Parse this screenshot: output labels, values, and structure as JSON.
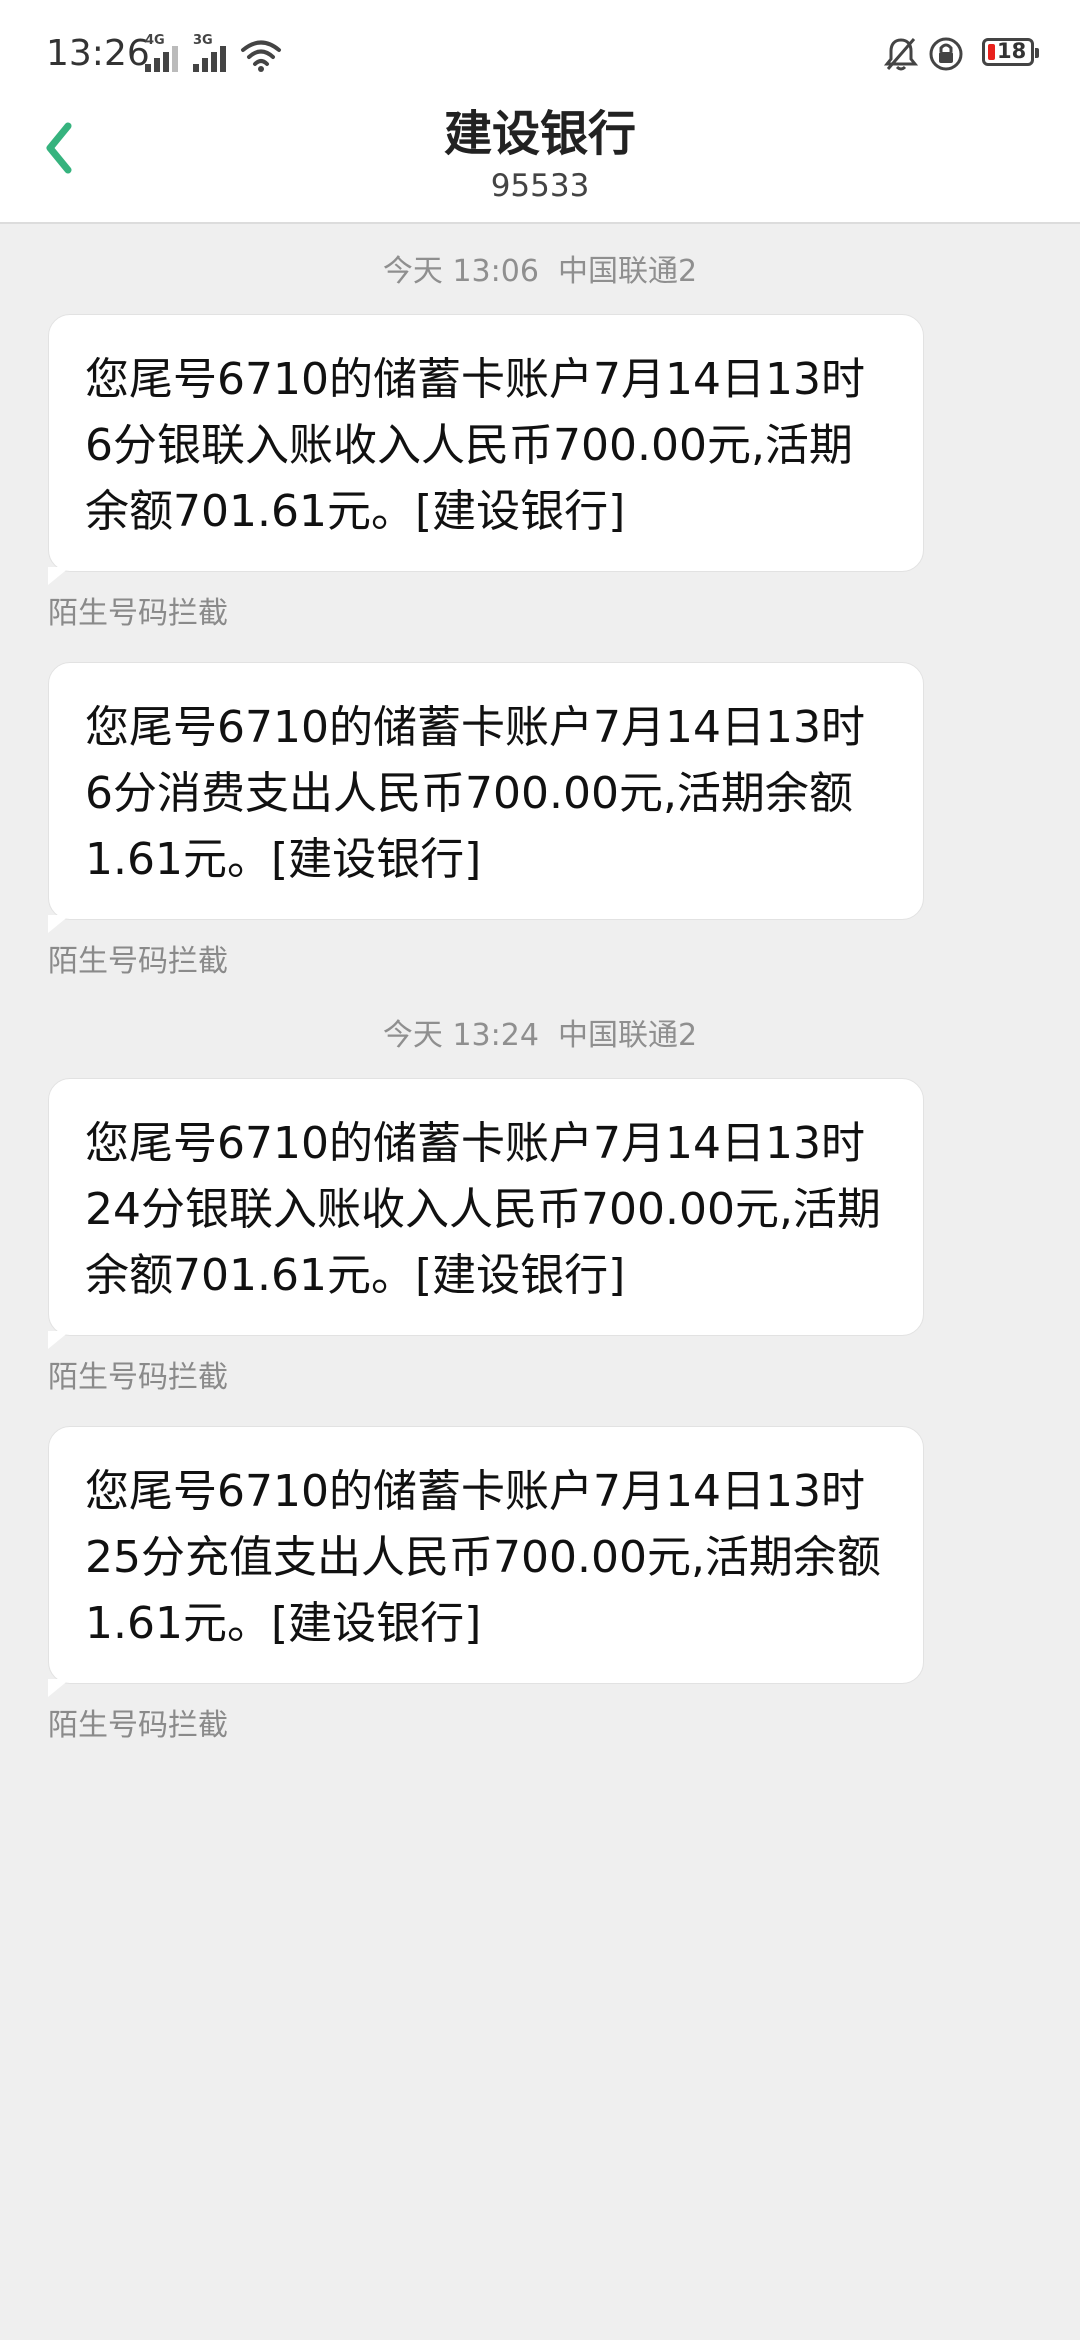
{
  "status_bar": {
    "time": "13:26",
    "network_1": "4G",
    "network_2": "3G",
    "battery_level": "18",
    "icons": [
      "signal-4g-icon",
      "signal-3g-icon",
      "wifi-icon",
      "bell-muted-icon",
      "rotation-lock-icon",
      "battery-icon"
    ]
  },
  "header": {
    "title": "建设银行",
    "subtitle": "95533",
    "back_icon": "chevron-left-icon",
    "accent_color": "#36b37e"
  },
  "messages": [
    {
      "separator": "今天 13:06  中国联通2",
      "text": "您尾号6710的储蓄卡账户7月14日13时6分银联入账收入人民币700.00元,活期余额701.61元。[建设银行]",
      "label": "陌生号码拦截"
    },
    {
      "separator": "",
      "text": "您尾号6710的储蓄卡账户7月14日13时6分消费支出人民币700.00元,活期余额1.61元。[建设银行]",
      "label": "陌生号码拦截"
    },
    {
      "separator": "今天 13:24  中国联通2",
      "text": "您尾号6710的储蓄卡账户7月14日13时24分银联入账收入人民币700.00元,活期余额701.61元。[建设银行]",
      "label": "陌生号码拦截"
    },
    {
      "separator": "",
      "text": "您尾号6710的储蓄卡账户7月14日13时25分充值支出人民币700.00元,活期余额1.61元。[建设银行]",
      "label": "陌生号码拦截"
    }
  ]
}
